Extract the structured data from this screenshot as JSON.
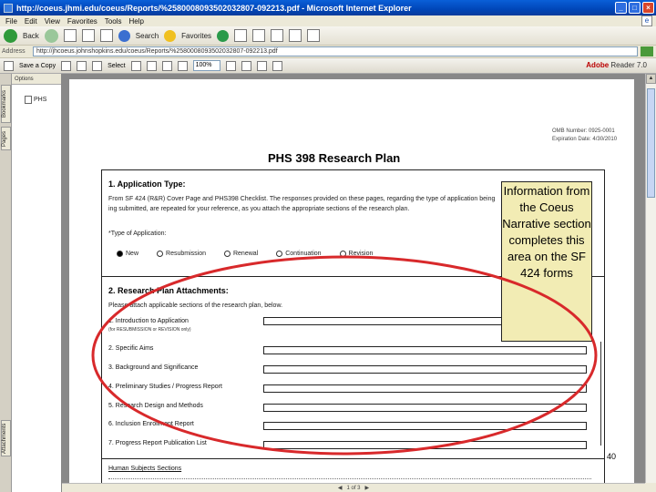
{
  "window": {
    "title": "http://coeus.jhmi.edu/coeus/Reports/%2580008093502032807-092213.pdf - Microsoft Internet Explorer"
  },
  "menu": [
    "File",
    "Edit",
    "View",
    "Favorites",
    "Tools",
    "Help"
  ],
  "toolbar": {
    "back_label": "Back",
    "search_label": "Search",
    "favorites_label": "Favorites"
  },
  "address": {
    "label": "Address",
    "url": "http://jhcoeus.johnshopkins.edu/coeus/Reports/%2580008093502032807-092213.pdf"
  },
  "adobe_toolbar": {
    "save_label": "Save a Copy",
    "select_label": "Select",
    "zoom_value": "100%",
    "brand": "Adobe",
    "product": "Reader 7.0"
  },
  "side_tabs": [
    "Bookmarks",
    "Pages",
    "Attachments"
  ],
  "bookmarks": {
    "header": "Options",
    "item": "PHS"
  },
  "form": {
    "omb_line1": "OMB Number: 0925-0001",
    "omb_line2": "Expiration Date: 4/30/2010",
    "title": "PHS 398 Research Plan",
    "section1_title": "1. Application Type:",
    "section1_text1": "From SF 424 (R&R) Cover Page and PHS398 Checklist. The responses provided on these pages, regarding the type of application being",
    "section1_text2": "ing submitted, are repeated for your reference, as you attach the appropriate sections of the research plan.",
    "type_label": "*Type of Application:",
    "radio_options": [
      "New",
      "Resubmission",
      "Renewal",
      "Continuation",
      "Revision"
    ],
    "section2_title": "2. Research Plan Attachments:",
    "section2_text": "Please attach applicable sections of the research plan, below.",
    "attachments": [
      "1. Introduction to Application",
      "2. Specific Aims",
      "3. Background and Significance",
      "4. Preliminary Studies / Progress Report",
      "5. Research Design and Methods",
      "6. Inclusion Enrollment Report",
      "7. Progress Report Publication List"
    ],
    "attachment1_note": "(for RESUBMISSION or REVISION only)",
    "human_subjects": "Human Subjects Sections"
  },
  "callout": {
    "text": "Information from the Coeus Narrative section completes this area on the SF 424 forms"
  },
  "page_number": "40",
  "status": {
    "page_indicator": "1 of 3"
  },
  "colors": {
    "callout_bg": "#f2ecb4",
    "ellipse": "#d8292b",
    "titlebar": "#0a5fd8"
  }
}
